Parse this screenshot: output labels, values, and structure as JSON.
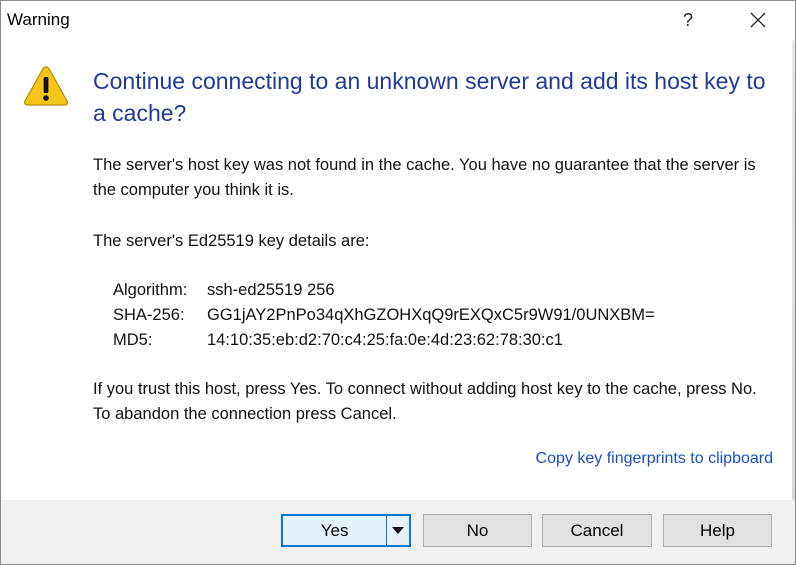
{
  "window": {
    "title": "Warning",
    "help_glyph": "?"
  },
  "heading": "Continue connecting to an unknown server and add its host key to a cache?",
  "paragraphs": {
    "p1": "The server's host key was not found in the cache. You have no guarantee that the server is the computer you think it is.",
    "p2": "The server's Ed25519 key details are:",
    "p3": "If you trust this host, press Yes. To connect without adding host key to the cache, press No. To abandon the connection press Cancel."
  },
  "key_details": [
    {
      "label": "Algorithm:",
      "value": "ssh-ed25519 256"
    },
    {
      "label": "SHA-256:",
      "value": "GG1jAY2PnPo34qXhGZOHXqQ9rEXQxC5r9W91/0UNXBM="
    },
    {
      "label": "MD5:",
      "value": "14:10:35:eb:d2:70:c4:25:fa:0e:4d:23:62:78:30:c1"
    }
  ],
  "copy_link": "Copy key fingerprints to clipboard",
  "buttons": {
    "yes": "Yes",
    "no": "No",
    "cancel": "Cancel",
    "help": "Help"
  },
  "icons": {
    "warning": "warning-triangle-icon",
    "close": "close-icon",
    "dropdown": "dropdown-arrow-icon"
  },
  "colors": {
    "heading": "#1e3a9a",
    "link": "#1a4fbf",
    "default_button_border": "#0078d7",
    "warning_fill": "#f5c518"
  }
}
